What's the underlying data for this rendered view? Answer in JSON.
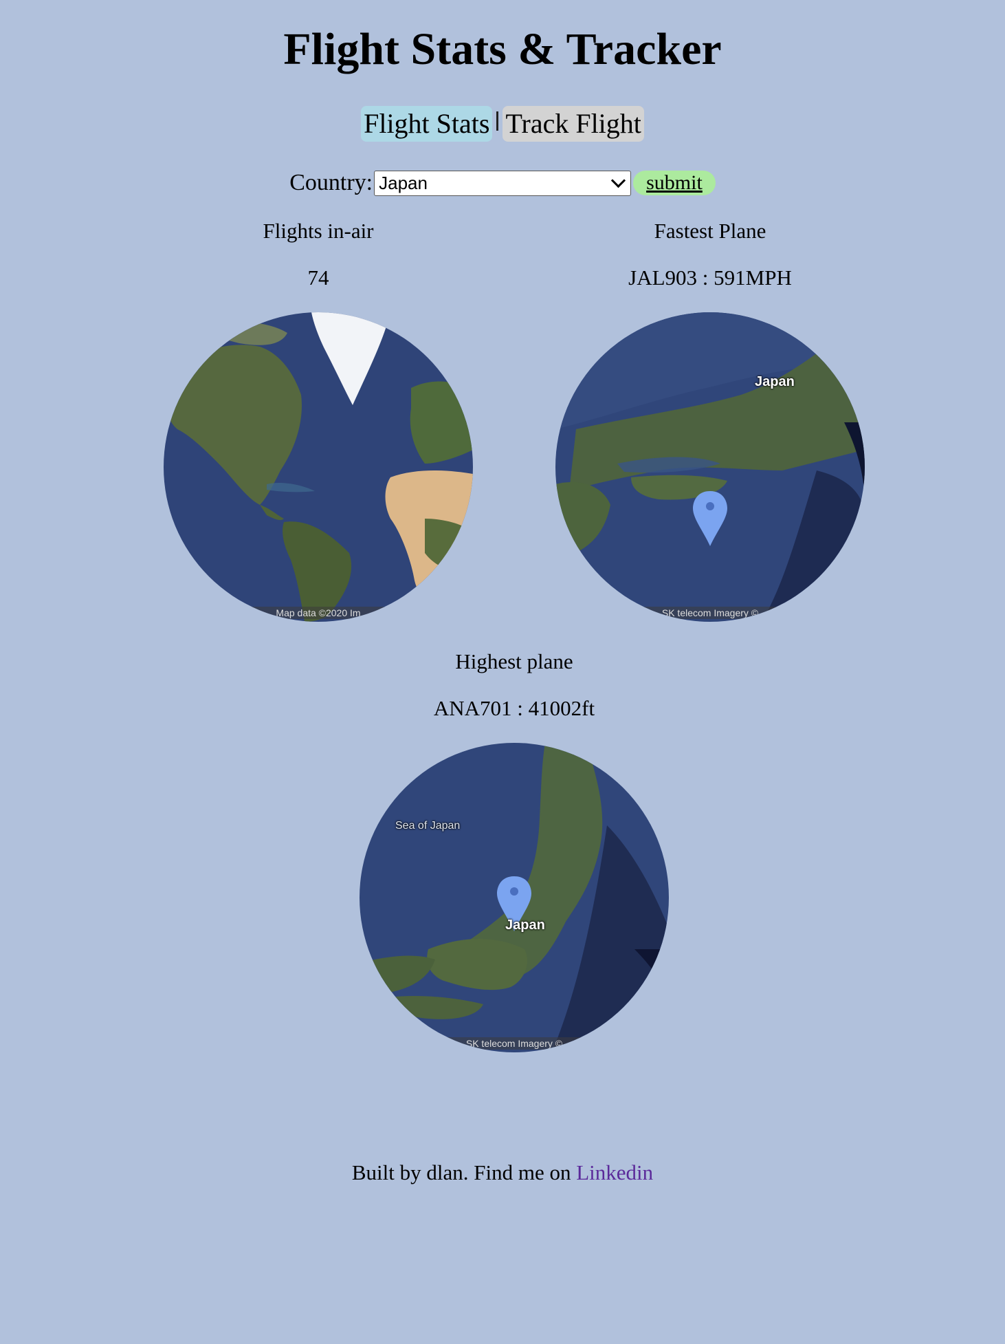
{
  "header": {
    "title": "Flight Stats & Tracker"
  },
  "tabs": [
    {
      "label": "Flight Stats",
      "active": true
    },
    {
      "label": "Track Flight",
      "active": false
    }
  ],
  "filter": {
    "label": "Country:",
    "selected": "Japan",
    "submit_label": "submit"
  },
  "stats": {
    "flights_in_air": {
      "label": "Flights in-air",
      "value": "74"
    },
    "fastest_plane": {
      "label": "Fastest Plane",
      "value": "JAL903 : 591MPH"
    },
    "highest_plane": {
      "label": "Highest plane",
      "value": "ANA701 : 41002ft"
    }
  },
  "maps": {
    "world": {
      "attribution": "Map data ©2020  Im"
    },
    "fastest": {
      "place_label": "Japan",
      "attribution": "SK telecom  Imagery ©"
    },
    "highest": {
      "place_label": "Japan",
      "sea_label": "Sea of Japan",
      "attribution": "SK telecom  Imagery ©"
    }
  },
  "footer": {
    "text": "Built by dlan. Find me on ",
    "link_label": "Linkedin"
  },
  "colors": {
    "background": "#b1c1dc",
    "tab_active": "#add8e6",
    "tab_inactive": "#d3d3d3",
    "submit": "#acea9e",
    "link": "#5b2a9a",
    "marker": "#7ba4f0"
  }
}
